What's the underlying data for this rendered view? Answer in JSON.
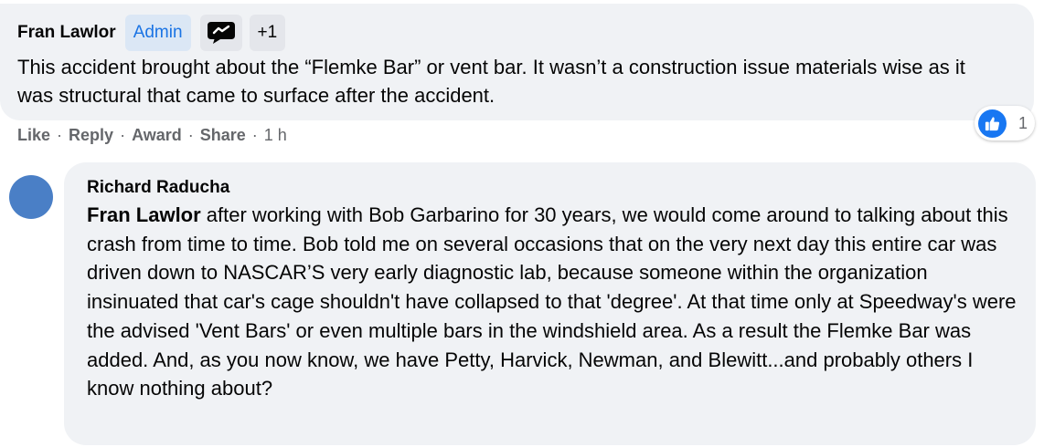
{
  "comment1": {
    "author": "Fran Lawlor",
    "badge_role": "Admin",
    "badge_icon": "chat-bubble-icon",
    "badge_more": "+1",
    "text": "This accident brought about the “Flemke Bar” or vent bar. It wasn’t a construction issue materials wise as it was structural that came to surface after the accident.",
    "actions": {
      "like": "Like",
      "reply": "Reply",
      "award": "Award",
      "share": "Share",
      "time": "1 h"
    },
    "reaction": {
      "icon": "thumbs-up-icon",
      "count": "1"
    }
  },
  "comment2": {
    "author": "Richard Raducha",
    "mention": "Fran Lawlor",
    "text": " after working with Bob Garbarino for 30 years, we would come around to talking about this crash from time to time. Bob told me on several occasions that on the very next day this entire car was driven down to NASCAR’S very early diagnostic lab, because someone within the organization insinuated that car's cage shouldn't have collapsed to that 'degree'. At that time only at Speedway's were the advised 'Vent Bars' or even multiple bars in the windshield area. As a result the Flemke Bar was added. And, as you now know, we have Petty, Harvick, Newman, and Blewitt...and probably others I know nothing about?"
  },
  "colors": {
    "bubble": "#f0f2f5",
    "accent_blue": "#1877f2",
    "admin_text": "#1b74e4",
    "secondary_text": "#65676b"
  }
}
